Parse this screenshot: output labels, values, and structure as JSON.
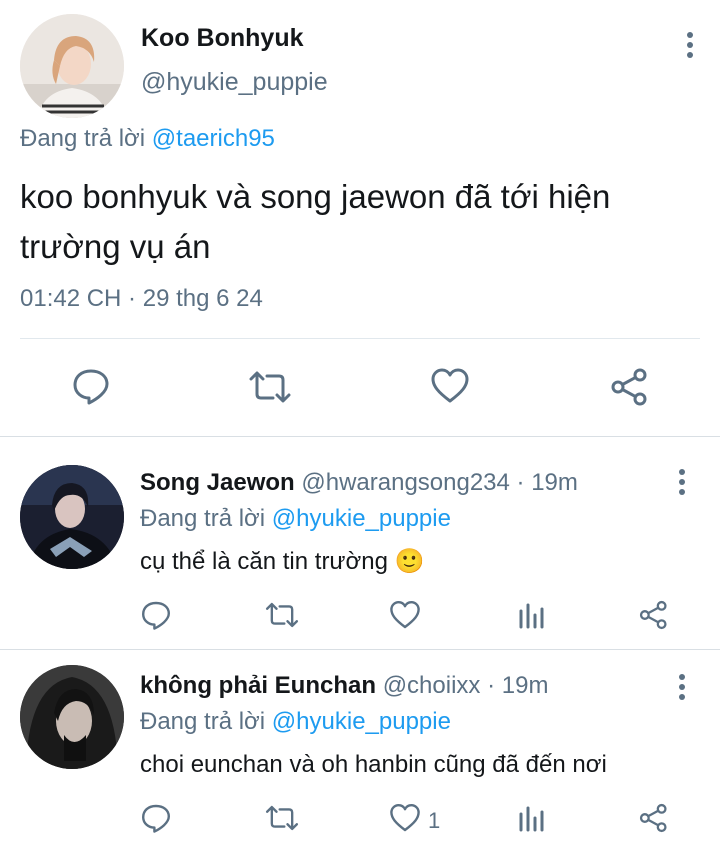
{
  "main_tweet": {
    "name": "Koo Bonhyuk",
    "handle": "@hyukie_puppie",
    "replying_prefix": "Đang trả lời",
    "replying_to": "@taerich95",
    "text": "koo bonhyuk và song jaewon đã tới hiện trường vụ án",
    "timestamp": "01:42 CH · 29 thg 6 24",
    "actions": [
      "reply-icon",
      "retweet-icon",
      "like-icon",
      "share-icon"
    ]
  },
  "replies": [
    {
      "name": "Song Jaewon",
      "handle": "@hwarangsong234",
      "separator": " · ",
      "time": "19m",
      "replying_prefix": "Đang trả lời",
      "replying_to": "@hyukie_puppie",
      "text": "cụ thể là căn tin trường",
      "emoji": "🙂",
      "like_count": ""
    },
    {
      "name": "không phải Eunchan",
      "handle": "@choiixx",
      "separator": " · ",
      "time": "19m",
      "replying_prefix": "Đang trả lời",
      "replying_to": "@hyukie_puppie",
      "text": "choi eunchan và oh hanbin cũng đã đến nơi",
      "like_count": "1"
    }
  ],
  "colors": {
    "accent": "#1d9bf0",
    "secondary_text": "#5b7083",
    "primary_text": "#14171a",
    "divider": "#e1e8ed"
  }
}
